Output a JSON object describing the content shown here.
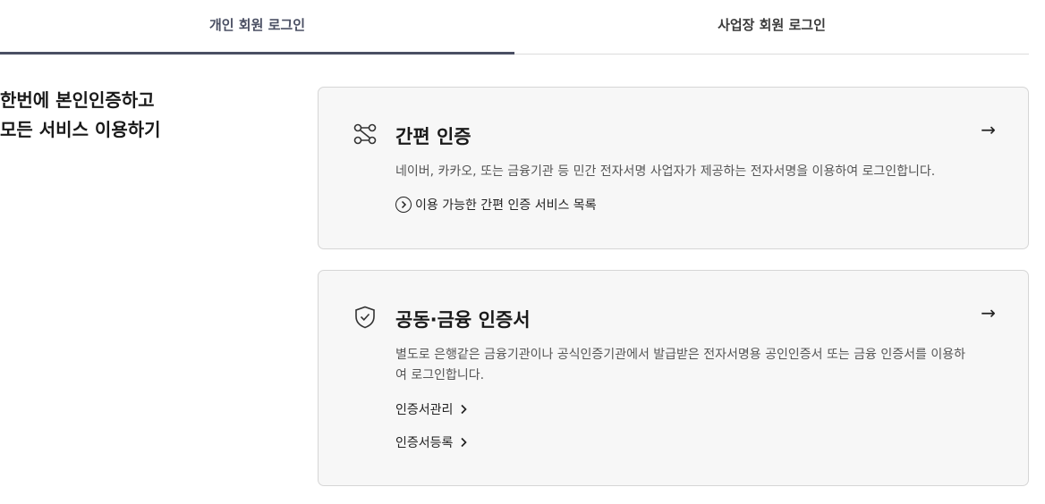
{
  "tabs": [
    {
      "label": "개인 회원 로그인",
      "active": true
    },
    {
      "label": "사업장 회원 로그인",
      "active": false
    }
  ],
  "headline": {
    "line1": "한번에 본인인증하고",
    "line2": "모든 서비스 이용하기"
  },
  "cards": {
    "simple": {
      "icon": "network-nodes-icon",
      "title": "간편 인증",
      "description": "네이버, 카카오, 또는 금융기관 등 민간 전자서명 사업자가 제공하는 전자서명을 이용하여 로그인합니다.",
      "link": "이용 가능한 간편 인증 서비스 목록",
      "arrow": "→"
    },
    "certificate": {
      "icon": "shield-check-icon",
      "title": "공동·금융 인증서",
      "description": "별도로 은행같은 금융기관이나 공식인증기관에서 발급받은 전자서명용 공인인증서 또는 금융 인증서를 이용하여 로그인합니다.",
      "links": [
        "인증서관리",
        "인증서등록"
      ],
      "arrow": "→"
    }
  },
  "colors": {
    "active_tab": "#4a4f63",
    "card_bg": "#f7f7f7",
    "card_border": "#d6d6d6"
  }
}
